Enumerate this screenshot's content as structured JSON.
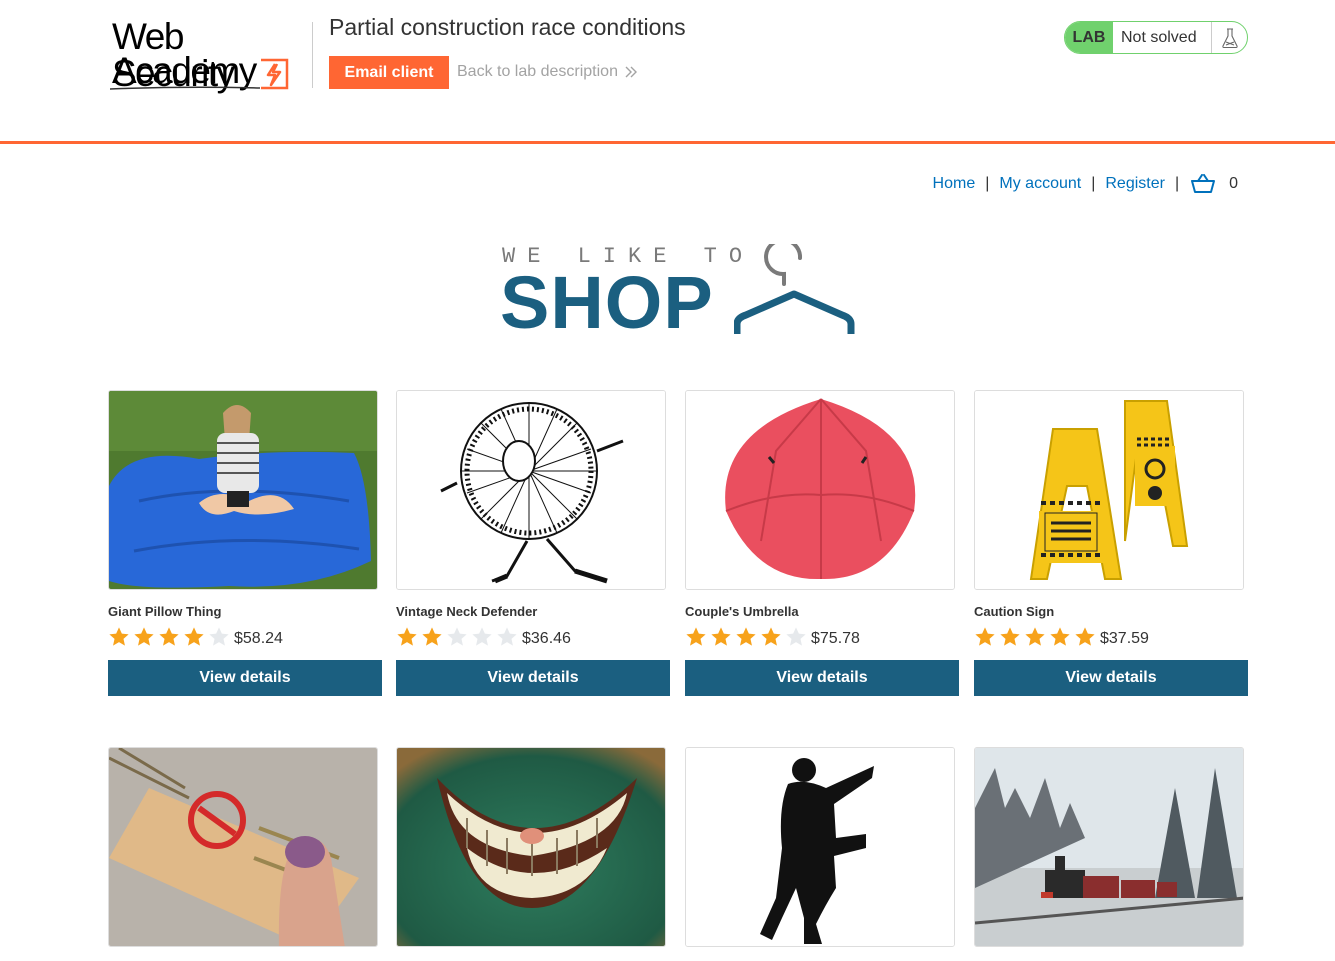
{
  "academy": {
    "logo_line1": "Web Security",
    "logo_line2": "Academy",
    "lab_title": "Partial construction race conditions",
    "email_client_label": "Email client",
    "back_link_label": "Back to lab description",
    "lab_badge": "LAB",
    "lab_state": "Not solved",
    "colors": {
      "accent": "#ff6633",
      "solved_green": "#70d16d",
      "primary_blue": "#1b5f80",
      "link_blue": "#0071bc"
    }
  },
  "nav": {
    "home": "Home",
    "my_account": "My account",
    "register": "Register",
    "separator": "|",
    "cart_icon": "basket-icon",
    "cart_count": "0"
  },
  "banner": {
    "small_text": "WE LIKE TO",
    "big_text": "SHOP",
    "icon": "hanger-icon"
  },
  "products": [
    {
      "name": "Giant Pillow Thing",
      "rating": 4,
      "price": "$58.24",
      "button": "View details"
    },
    {
      "name": "Vintage Neck Defender",
      "rating": 2,
      "price": "$36.46",
      "button": "View details"
    },
    {
      "name": "Couple's Umbrella",
      "rating": 4,
      "price": "$75.78",
      "button": "View details"
    },
    {
      "name": "Caution Sign",
      "rating": 5,
      "price": "$37.59",
      "button": "View details"
    },
    {
      "name": "",
      "rating": 0,
      "price": "",
      "button": ""
    },
    {
      "name": "",
      "rating": 0,
      "price": "",
      "button": ""
    },
    {
      "name": "",
      "rating": 0,
      "price": "",
      "button": ""
    },
    {
      "name": "",
      "rating": 0,
      "price": "",
      "button": ""
    }
  ]
}
